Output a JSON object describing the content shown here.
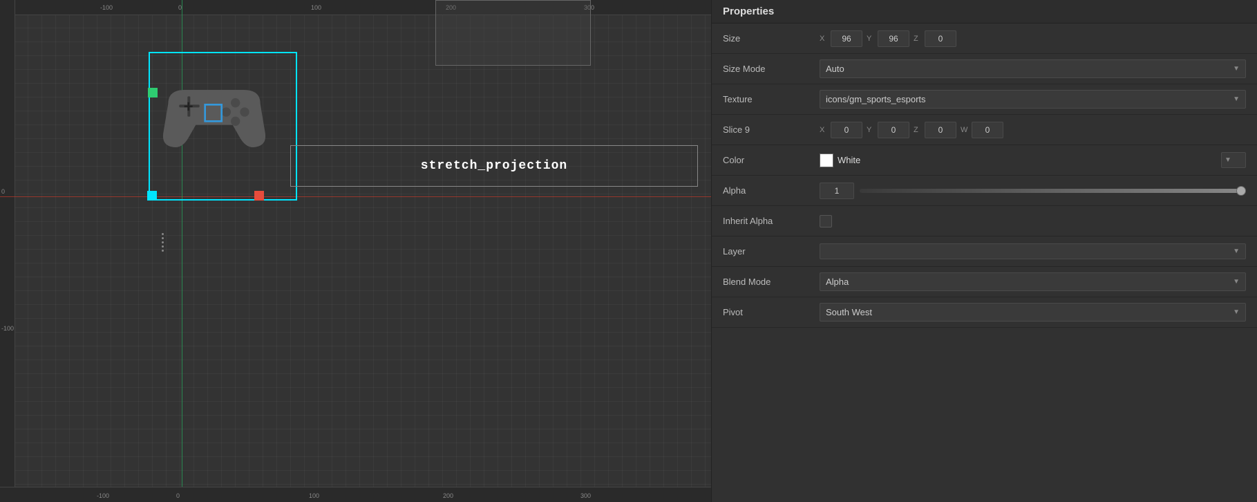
{
  "panel": {
    "title": "Properties"
  },
  "properties": {
    "size": {
      "label": "Size",
      "x_label": "X",
      "y_label": "Y",
      "z_label": "Z",
      "x_val": "96",
      "y_val": "96",
      "z_val": "0"
    },
    "size_mode": {
      "label": "Size Mode",
      "value": "Auto"
    },
    "texture": {
      "label": "Texture",
      "value": "icons/gm_sports_esports"
    },
    "slice9": {
      "label": "Slice 9",
      "x_label": "X",
      "y_label": "Y",
      "z_label": "Z",
      "w_label": "W",
      "x_val": "0",
      "y_val": "0",
      "z_val": "0",
      "w_val": "0"
    },
    "color": {
      "label": "Color",
      "value": "White",
      "swatch": "#ffffff"
    },
    "alpha": {
      "label": "Alpha",
      "value": "1"
    },
    "inherit_alpha": {
      "label": "Inherit Alpha"
    },
    "layer": {
      "label": "Layer",
      "value": ""
    },
    "blend_mode": {
      "label": "Blend Mode",
      "value": "Alpha"
    },
    "pivot": {
      "label": "Pivot",
      "value": "South West"
    }
  },
  "canvas": {
    "stretch_label": "stretch_projection",
    "ruler_labels_h": [
      "-100",
      "0",
      "100",
      "200",
      "300"
    ],
    "ruler_labels_v": [
      "0",
      "-100"
    ]
  }
}
